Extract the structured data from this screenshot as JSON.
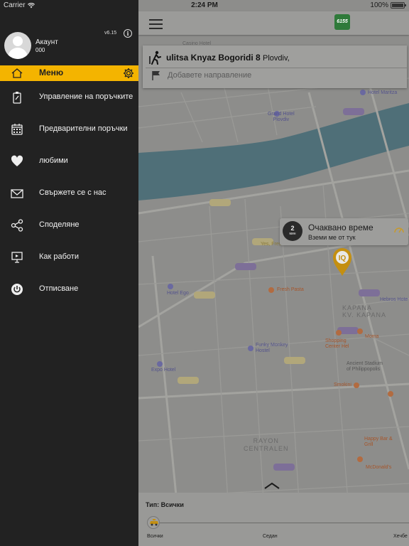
{
  "status_bar": {
    "carrier": "Carrier",
    "time": "2:24 PM",
    "battery": "100%"
  },
  "drawer": {
    "account_name": "Акаунт",
    "account_id": "000",
    "version": "v6.15",
    "menu_title": "Меню",
    "items": [
      {
        "label": "Управление на поръчките",
        "icon": "order-clipboard-icon"
      },
      {
        "label": "Предварителни поръчки",
        "icon": "calendar-icon"
      },
      {
        "label": "любими",
        "icon": "heart-icon"
      },
      {
        "label": "Свържете се с нас",
        "icon": "envelope-icon"
      },
      {
        "label": "Споделяне",
        "icon": "share-icon"
      },
      {
        "label": "Как работи",
        "icon": "presentation-icon"
      },
      {
        "label": "Отписване",
        "icon": "power-icon"
      }
    ]
  },
  "header": {
    "brand": "6155"
  },
  "address": {
    "from_street": "ulitsa Knyaz Bogoridi 8",
    "from_city": "Plovdiv,",
    "to_placeholder": "Добавете направление"
  },
  "wait": {
    "minutes": "2",
    "unit": "мин",
    "title": "Очаквано време",
    "subtitle": "Вземи ме от тук"
  },
  "map_labels": {
    "casino": "Casino Hotel",
    "grand_hotel": "Grand Hotel\nPlovdiv",
    "hotel_maritza": "Hotel Maritza",
    "hotel_ego": "Hotel Ego",
    "fresh_pasta": "Fresh Pasta",
    "kapana": "KAPANA\nKV. KAPANA",
    "shopping": "Shopping\nCenter Hel",
    "moma": "Moma",
    "stadium": "Ancient Stadium\nof Philippopolis",
    "funky": "Funky Monkey\nHostel",
    "expo": "Expo Hotel",
    "smokini": "Smokini",
    "rayon": "RAYON\nCENTRALEN",
    "happy": "Happy Bar &\nGrill",
    "mcd": "McDonald's",
    "hebros": "Hebros Hote",
    "yes_fresh": "Yes, Fresh"
  },
  "bottom": {
    "type_label": "Тип: Всички",
    "options": [
      "Всички",
      "Седан",
      "Хечбе"
    ]
  },
  "colors": {
    "accent": "#f4b400",
    "drawer_bg": "#222222"
  }
}
